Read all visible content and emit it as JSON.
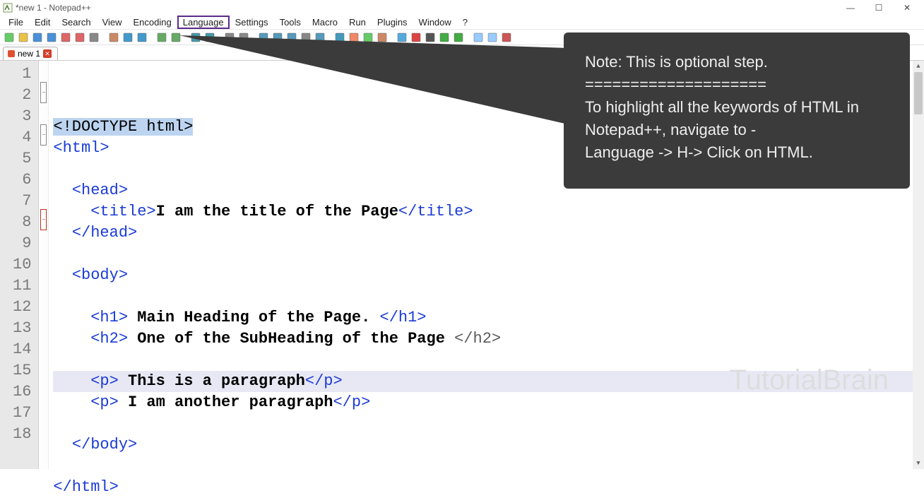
{
  "window": {
    "title": "*new 1 - Notepad++"
  },
  "menu": {
    "items": [
      "File",
      "Edit",
      "Search",
      "View",
      "Encoding",
      "Language",
      "Settings",
      "Tools",
      "Macro",
      "Run",
      "Plugins",
      "Window",
      "?"
    ],
    "highlight_index": 5
  },
  "tab": {
    "label": "new 1"
  },
  "code": {
    "lines": [
      {
        "n": 1,
        "type": "doctype",
        "text": "<!DOCTYPE html>"
      },
      {
        "n": 2,
        "type": "tag",
        "indent": 0,
        "open": "<html>",
        "fold": "minus"
      },
      {
        "n": 3,
        "type": "blank"
      },
      {
        "n": 4,
        "type": "tag",
        "indent": 1,
        "open": "<head>",
        "fold": "minus"
      },
      {
        "n": 5,
        "type": "pair",
        "indent": 2,
        "open": "<title>",
        "text": "I am the title of the Page",
        "close": "</title>"
      },
      {
        "n": 6,
        "type": "tag",
        "indent": 1,
        "open": "</head>"
      },
      {
        "n": 7,
        "type": "blank"
      },
      {
        "n": 8,
        "type": "tag",
        "indent": 1,
        "open": "<body>",
        "fold": "minus-red"
      },
      {
        "n": 9,
        "type": "blank"
      },
      {
        "n": 10,
        "type": "pair",
        "indent": 2,
        "open": "<h1>",
        "text": " Main Heading of the Page. ",
        "close": "</h1>"
      },
      {
        "n": 11,
        "type": "pair-h2",
        "indent": 2,
        "open": "<h2>",
        "text": " One of the SubHeading of the Page ",
        "close": "</h2>"
      },
      {
        "n": 12,
        "type": "blank"
      },
      {
        "n": 13,
        "type": "pair",
        "indent": 2,
        "open": "<p>",
        "text": " This is a paragraph",
        "close": "</p>",
        "current": true
      },
      {
        "n": 14,
        "type": "pair",
        "indent": 2,
        "open": "<p>",
        "text": " I am another paragraph",
        "close": "</p>"
      },
      {
        "n": 15,
        "type": "blank"
      },
      {
        "n": 16,
        "type": "tag",
        "indent": 1,
        "open": "</body>"
      },
      {
        "n": 17,
        "type": "blank"
      },
      {
        "n": 18,
        "type": "tag",
        "indent": 0,
        "open": "</html>"
      }
    ]
  },
  "callout": {
    "line1": "Note: This is optional step.",
    "sep": "====================",
    "line2": "To highlight all the keywords of HTML in Notepad++, navigate to -",
    "line3": "Language -> H-> Click on HTML."
  },
  "watermark": "TutorialBrain",
  "toolbar_icons": [
    "new-file",
    "open-file",
    "save",
    "save-all",
    "close",
    "close-all",
    "print",
    "sep",
    "cut",
    "copy",
    "paste",
    "sep",
    "undo",
    "redo",
    "sep",
    "find",
    "replace",
    "sep",
    "zoom-in",
    "zoom-out",
    "sep",
    "sync-v",
    "sync-h",
    "wrap",
    "invisible",
    "indent-guide",
    "sep",
    "lang-panel",
    "doc-map",
    "func-list",
    "folder",
    "sep",
    "monitor",
    "record",
    "stop",
    "play",
    "play-multi",
    "sep",
    "toggle-1",
    "toggle-2",
    "abc-spell"
  ]
}
